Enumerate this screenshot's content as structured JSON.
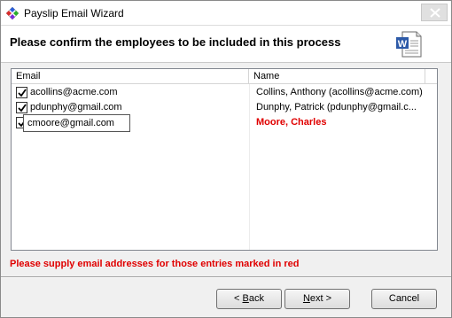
{
  "window": {
    "title": "Payslip Email Wizard",
    "header": "Please confirm the employees to be included in this process",
    "icons": {
      "app": "diamond-app-icon",
      "header": "word-document-icon",
      "close": "close-icon"
    }
  },
  "table": {
    "columns": {
      "email": "Email",
      "name": "Name"
    },
    "rows": [
      {
        "checked": true,
        "email": "acollins@acme.com",
        "name": "Collins, Anthony (acollins@acme.com)",
        "missing_email": false
      },
      {
        "checked": true,
        "email": "pdunphy@gmail.com",
        "name": "Dunphy, Patrick (pdunphy@gmail.c...",
        "missing_email": false
      },
      {
        "checked": true,
        "email": "cmoore@gmail.com",
        "name": "Moore, Charles",
        "missing_email": true,
        "editing": true
      }
    ]
  },
  "warning": "Please supply email addresses for those entries marked in red",
  "buttons": {
    "back_hotkey": "B",
    "back_rest": "ack",
    "back_prefix": "< ",
    "next_hotkey": "N",
    "next_rest": "ext >",
    "cancel": "Cancel"
  },
  "colors": {
    "warning": "#e00000",
    "missing_name": "#e00000"
  }
}
